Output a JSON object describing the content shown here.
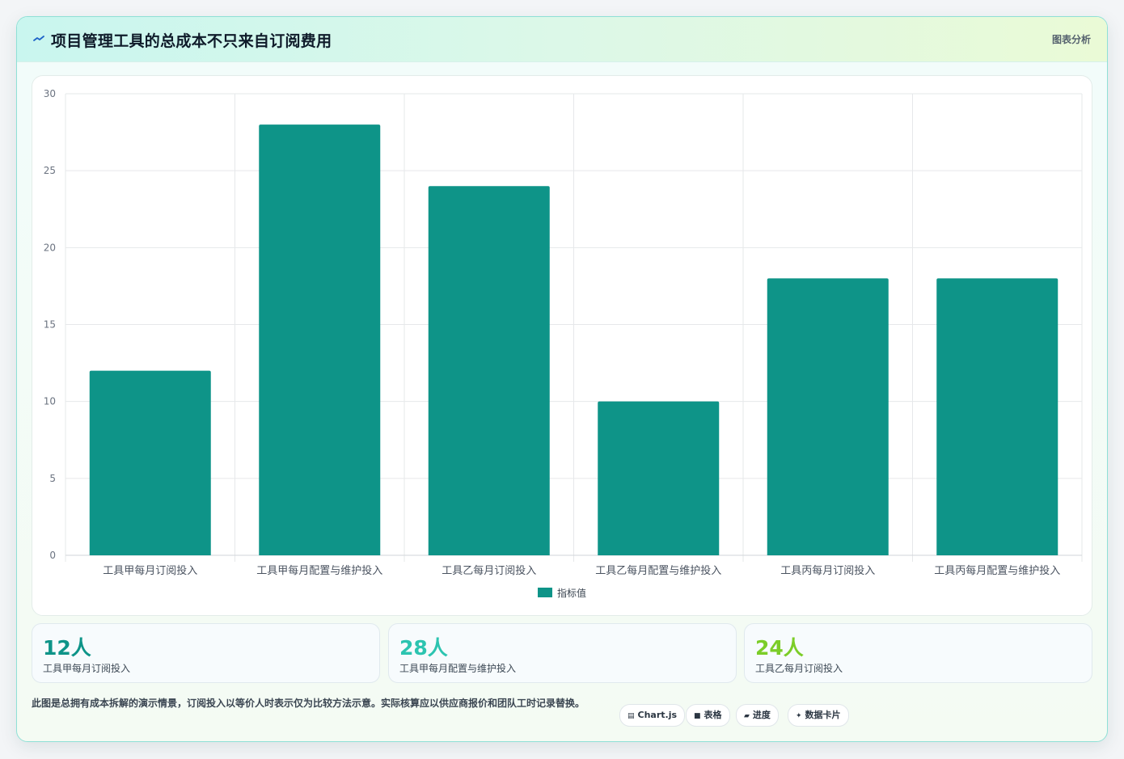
{
  "header": {
    "title": "项目管理工具的总成本不只来自订阅费用",
    "action_label": "图表分析"
  },
  "chart_data": {
    "type": "bar",
    "categories": [
      "工具甲每月订阅投入",
      "工具甲每月配置与维护投入",
      "工具乙每月订阅投入",
      "工具乙每月配置与维护投入",
      "工具丙每月订阅投入",
      "工具丙每月配置与维护投入"
    ],
    "series": [
      {
        "name": "指标值",
        "values": [
          12,
          28,
          24,
          10,
          18,
          18
        ],
        "color": "#0e9488"
      }
    ],
    "ylim": [
      0,
      30
    ],
    "yticks": [
      0,
      5,
      10,
      15,
      20,
      25,
      30
    ],
    "grid": true,
    "legend": "bottom-center",
    "xlabel": "",
    "ylabel": ""
  },
  "stats": [
    {
      "value": "12人",
      "label": "工具甲每月订阅投入",
      "color": "#0e9488"
    },
    {
      "value": "28人",
      "label": "工具甲每月配置与维护投入",
      "color": "#2cc4b0"
    },
    {
      "value": "24人",
      "label": "工具乙每月订阅投入",
      "color": "#7ccd28"
    }
  ],
  "footnote": "此图是总拥有成本拆解的演示情景，订阅投入以等价人时表示仅为比较方法示意。实际核算应以供应商报价和团队工时记录替换。",
  "tags": [
    {
      "icon": "▤",
      "label": "Chart.js"
    },
    {
      "icon": "■",
      "label": "表格"
    },
    {
      "icon": "▰",
      "label": "进度"
    },
    {
      "icon": "✦",
      "label": "数据卡片"
    }
  ],
  "colors": {
    "accent": "#0e9488",
    "border": "#8fe0d6"
  }
}
